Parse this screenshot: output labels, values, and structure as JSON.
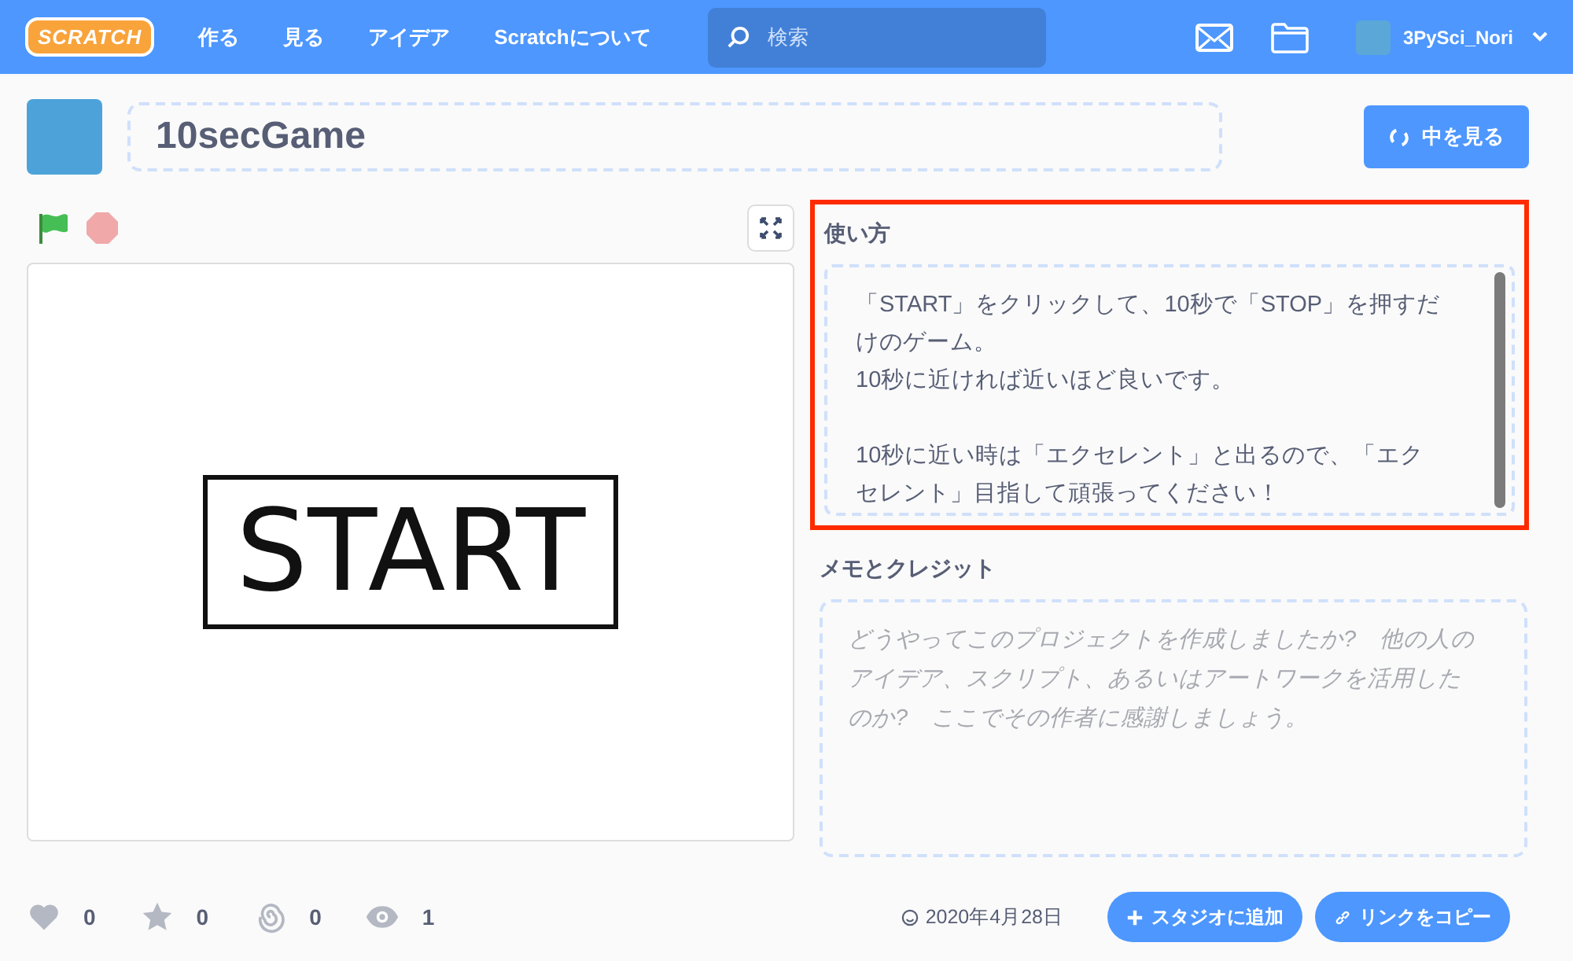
{
  "navbar": {
    "logo": "SCRATCH",
    "links": [
      "作る",
      "見る",
      "アイデア",
      "Scratchについて"
    ],
    "search": {
      "placeholder": "検索"
    },
    "username": "3PySci_Nori"
  },
  "project": {
    "title": "10secGame",
    "see_inside_button": "中を見る"
  },
  "stage": {
    "start_label": "START"
  },
  "instructions": {
    "heading": "使い方",
    "text": "「START」をクリックして、10秒で「STOP」を押すだけのゲーム。\n10秒に近ければ近いほど良いです。\n\n10秒に近い時は「エクセレント」と出るので、「エクセレント」目指して頑張ってください！",
    "highlighted": true
  },
  "notes": {
    "heading": "メモとクレジット",
    "placeholder": "どうやってこのプロジェクトを作成しましたか?　他の人のアイデア、スクリプト、あるいはアートワークを活用したのか?　ここでその作者に感謝しましょう。"
  },
  "stats": [
    {
      "kind": "love",
      "count": "0"
    },
    {
      "kind": "favorite",
      "count": "0"
    },
    {
      "kind": "remix",
      "count": "0"
    },
    {
      "kind": "view",
      "count": "1"
    }
  ],
  "date": "2020年4月28日",
  "buttons": [
    {
      "kind": "studio",
      "label": "スタジオに追加"
    },
    {
      "kind": "link",
      "label": "リンクをコピー"
    }
  ]
}
